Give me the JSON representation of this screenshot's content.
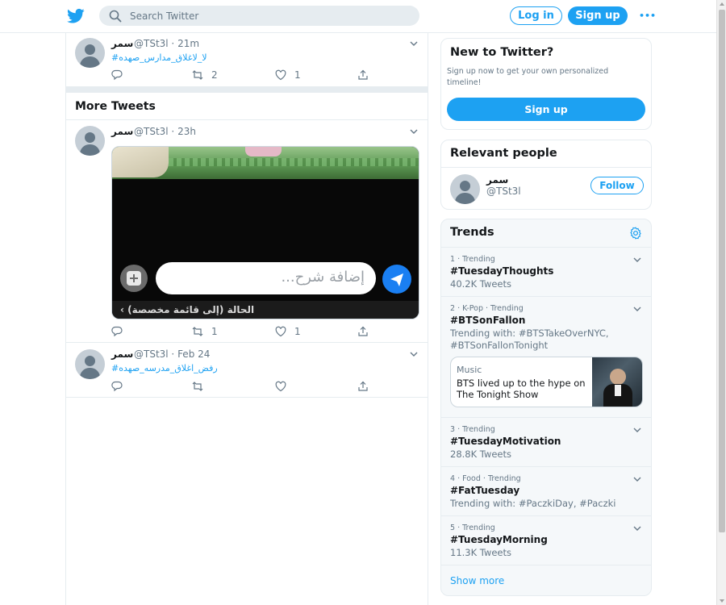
{
  "header": {
    "search_placeholder": "Search Twitter",
    "login_label": "Log in",
    "signup_label": "Sign up",
    "more_label": "•••"
  },
  "tweets_top": [
    {
      "name": "سمر",
      "handle": "@TSt3l · 21m",
      "text": "#لا_لاغلاق_مدارس_صهده",
      "retweets": "2",
      "likes": "1"
    }
  ],
  "more_tweets": {
    "heading": "More Tweets",
    "items": [
      {
        "name": "سمر",
        "handle": "@TSt3l · 23h",
        "media_caption_placeholder": "إضافة شرح...",
        "media_status": "الحالة (إلى قائمة مخصصة) ›",
        "retweets": "1",
        "likes": "1"
      },
      {
        "name": "سمر",
        "handle": "@TSt3l · Feb 24",
        "text": "#رفض_اغلاق_مدرسه_صهده",
        "retweets": "",
        "likes": ""
      }
    ]
  },
  "new_to_twitter": {
    "title": "New to Twitter?",
    "description": "Sign up now to get your own personalized timeline!",
    "button": "Sign up"
  },
  "relevant_people": {
    "title": "Relevant people",
    "name": "سمر",
    "handle": "@TSt3l",
    "follow_label": "Follow"
  },
  "trends": {
    "title": "Trends",
    "items": [
      {
        "meta": "1 · Trending",
        "name": "#TuesdayThoughts",
        "sub": "40.2K Tweets"
      },
      {
        "meta": "2 · K-Pop · Trending",
        "name": "#BTSonFallon",
        "sub": "Trending with: #BTSTakeOverNYC, #BTSonFallonTonight",
        "card": {
          "label": "Music",
          "text": "BTS lived up to the hype on The Tonight Show"
        }
      },
      {
        "meta": "3 · Trending",
        "name": "#TuesdayMotivation",
        "sub": "28.8K Tweets"
      },
      {
        "meta": "4 · Food · Trending",
        "name": "#FatTuesday",
        "sub": "Trending with: #PaczkiDay, #Paczki"
      },
      {
        "meta": "5 · Trending",
        "name": "#TuesdayMorning",
        "sub": "11.3K Tweets"
      }
    ],
    "show_more": "Show more"
  },
  "colors": {
    "accent": "#1da1f2",
    "text": "#14171a",
    "secondary": "#657786",
    "border": "#e6ecf0"
  }
}
